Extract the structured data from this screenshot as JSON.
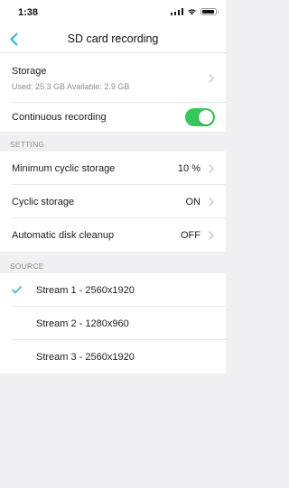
{
  "status_bar": {
    "time": "1:38"
  },
  "nav": {
    "title": "SD card recording"
  },
  "storage": {
    "label": "Storage",
    "detail": "Used: 25.3 GB Available: 2.9 GB"
  },
  "continuous_recording": {
    "label": "Continuous recording",
    "enabled": true
  },
  "setting_section": {
    "header": "SETTING",
    "items": [
      {
        "label": "Minimum cyclic storage",
        "value": "10 %"
      },
      {
        "label": "Cyclic storage",
        "value": "ON"
      },
      {
        "label": "Automatic disk cleanup",
        "value": "OFF"
      }
    ]
  },
  "source_section": {
    "header": "SOURCE",
    "streams": [
      {
        "label": "Stream 1 - 2560x1920",
        "selected": true
      },
      {
        "label": "Stream 2 - 1280x960",
        "selected": false
      },
      {
        "label": "Stream 3 - 2560x1920",
        "selected": false
      }
    ]
  },
  "colors": {
    "accent": "#2fb4c8",
    "toggle_on": "#34c759",
    "secondary_text": "#8e8e93"
  }
}
